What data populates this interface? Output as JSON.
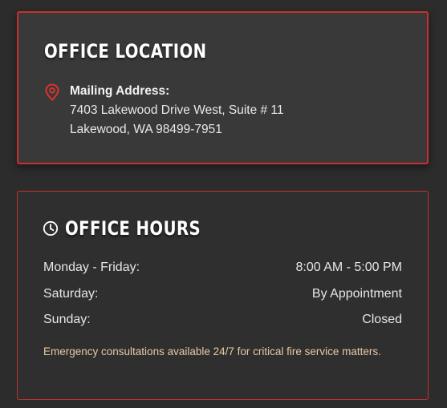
{
  "location": {
    "title": "OFFICE LOCATION",
    "icon": "map-pin-icon",
    "address_label": "Mailing Address:",
    "address_line1": "7403 Lakewood Drive West, Suite # 11",
    "address_line2": "Lakewood, WA 98499-7951"
  },
  "hours": {
    "title": "OFFICE HOURS",
    "icon": "clock-icon",
    "rows": [
      {
        "day": "Monday - Friday:",
        "time": "8:00 AM - 5:00 PM"
      },
      {
        "day": "Saturday:",
        "time": "By Appointment"
      },
      {
        "day": "Sunday:",
        "time": "Closed"
      }
    ],
    "note": "Emergency consultations available 24/7 for critical fire service matters."
  },
  "colors": {
    "accent": "#c9302c",
    "background": "#2c2c2c",
    "card_location_bg": "#393939",
    "note_text": "#e8c9a4"
  }
}
